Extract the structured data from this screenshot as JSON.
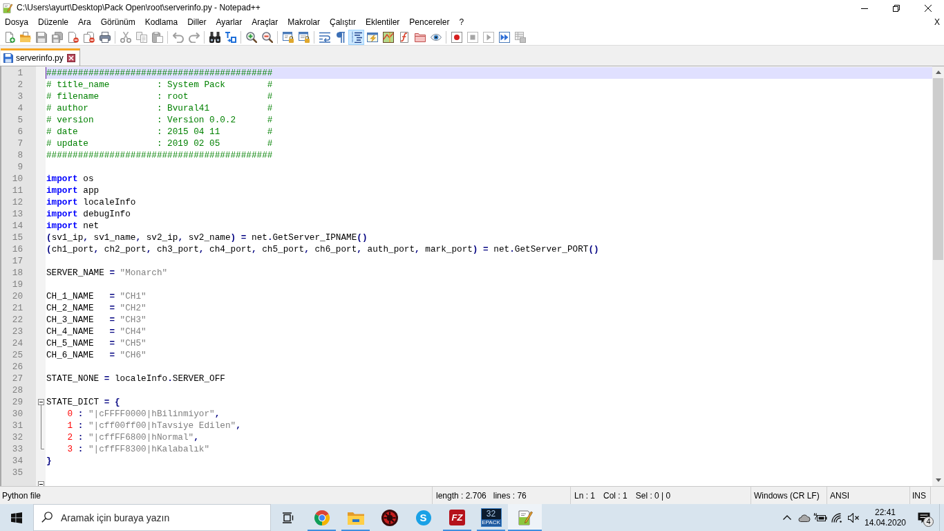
{
  "window": {
    "title": "C:\\Users\\ayurt\\Desktop\\Pack Open\\root\\serverinfo.py - Notepad++"
  },
  "menu_bar": {
    "items": [
      "Dosya",
      "Düzenle",
      "Ara",
      "Görünüm",
      "Kodlama",
      "Diller",
      "Ayarlar",
      "Araçlar",
      "Makrolar",
      "Çalıştır",
      "Eklentiler",
      "Pencereler",
      "?"
    ],
    "close_label": "X"
  },
  "toolbar": {
    "groups": [
      [
        {
          "kind": "new",
          "on": false,
          "disabled": false
        },
        {
          "kind": "open",
          "on": false,
          "disabled": false
        },
        {
          "kind": "save",
          "on": false,
          "disabled": true
        },
        {
          "kind": "saveall",
          "on": false,
          "disabled": true
        },
        {
          "kind": "close",
          "on": false,
          "disabled": false
        },
        {
          "kind": "closeall",
          "on": false,
          "disabled": false
        },
        {
          "kind": "print",
          "on": false,
          "disabled": false
        }
      ],
      [
        {
          "kind": "cut",
          "on": false,
          "disabled": true
        },
        {
          "kind": "copy",
          "on": false,
          "disabled": true
        },
        {
          "kind": "paste",
          "on": false,
          "disabled": true
        }
      ],
      [
        {
          "kind": "undo",
          "on": false,
          "disabled": true
        },
        {
          "kind": "redo",
          "on": false,
          "disabled": true
        }
      ],
      [
        {
          "kind": "find",
          "on": false,
          "disabled": false
        },
        {
          "kind": "replace",
          "on": false,
          "disabled": false
        }
      ],
      [
        {
          "kind": "zoomin",
          "on": false,
          "disabled": false
        },
        {
          "kind": "zoomout",
          "on": false,
          "disabled": false
        }
      ],
      [
        {
          "kind": "syncv",
          "on": false,
          "disabled": false
        },
        {
          "kind": "synch",
          "on": false,
          "disabled": false
        }
      ],
      [
        {
          "kind": "wrap",
          "on": false,
          "disabled": false
        },
        {
          "kind": "symbols",
          "on": false,
          "disabled": false
        },
        {
          "kind": "indent",
          "on": true,
          "disabled": false
        },
        {
          "kind": "language",
          "on": false,
          "disabled": false
        },
        {
          "kind": "docmap",
          "on": false,
          "disabled": false
        },
        {
          "kind": "functions",
          "on": false,
          "disabled": false
        },
        {
          "kind": "workspace",
          "on": false,
          "disabled": false
        },
        {
          "kind": "monitor",
          "on": false,
          "disabled": false
        }
      ],
      [
        {
          "kind": "record",
          "on": false,
          "disabled": false
        },
        {
          "kind": "stop",
          "on": false,
          "disabled": true
        },
        {
          "kind": "play",
          "on": false,
          "disabled": true
        },
        {
          "kind": "playmany",
          "on": false,
          "disabled": false
        },
        {
          "kind": "savemacro",
          "on": false,
          "disabled": true
        }
      ]
    ]
  },
  "tabs": [
    {
      "label": "serverinfo.py",
      "selected": true,
      "modified": false
    }
  ],
  "editor": {
    "lines": [
      {
        "number": "1",
        "kind": "plain",
        "current": true,
        "tokens": [
          {
            "kind": "comment",
            "text": "###########################################"
          }
        ]
      },
      {
        "number": "2",
        "kind": "plain",
        "current": false,
        "tokens": [
          {
            "kind": "comment",
            "text": "# title_name         : System Pack        #"
          }
        ]
      },
      {
        "number": "3",
        "kind": "plain",
        "current": false,
        "tokens": [
          {
            "kind": "comment",
            "text": "# filename           : root               #"
          }
        ]
      },
      {
        "number": "4",
        "kind": "plain",
        "current": false,
        "tokens": [
          {
            "kind": "comment",
            "text": "# author             : Bvural41           #"
          }
        ]
      },
      {
        "number": "5",
        "kind": "plain",
        "current": false,
        "tokens": [
          {
            "kind": "comment",
            "text": "# version            : Version 0.0.2      #"
          }
        ]
      },
      {
        "number": "6",
        "kind": "plain",
        "current": false,
        "tokens": [
          {
            "kind": "comment",
            "text": "# date               : 2015 04 11         #"
          }
        ]
      },
      {
        "number": "7",
        "kind": "plain",
        "current": false,
        "tokens": [
          {
            "kind": "comment",
            "text": "# update             : 2019 02 05         #"
          }
        ]
      },
      {
        "number": "8",
        "kind": "plain",
        "current": false,
        "tokens": [
          {
            "kind": "comment",
            "text": "###########################################"
          }
        ]
      },
      {
        "number": "9",
        "kind": "plain",
        "current": false
      },
      {
        "number": "10",
        "kind": "plain",
        "current": false,
        "tokens": [
          {
            "kind": "keyword",
            "text": "import"
          },
          {
            "kind": "plain",
            "text": " os"
          }
        ]
      },
      {
        "number": "11",
        "kind": "plain",
        "current": false,
        "tokens": [
          {
            "kind": "keyword",
            "text": "import"
          },
          {
            "kind": "plain",
            "text": " app"
          }
        ]
      },
      {
        "number": "12",
        "kind": "plain",
        "current": false,
        "tokens": [
          {
            "kind": "keyword",
            "text": "import"
          },
          {
            "kind": "plain",
            "text": " localeInfo"
          }
        ]
      },
      {
        "number": "13",
        "kind": "plain",
        "current": false,
        "tokens": [
          {
            "kind": "keyword",
            "text": "import"
          },
          {
            "kind": "plain",
            "text": " debugInfo"
          }
        ]
      },
      {
        "number": "14",
        "kind": "plain",
        "current": false,
        "tokens": [
          {
            "kind": "keyword",
            "text": "import"
          },
          {
            "kind": "plain",
            "text": " net"
          }
        ]
      },
      {
        "number": "15",
        "kind": "plain",
        "current": false,
        "tokens": [
          {
            "kind": "operator",
            "text": "("
          },
          {
            "kind": "plain",
            "text": "sv1_ip"
          },
          {
            "kind": "operator",
            "text": ","
          },
          {
            "kind": "plain",
            "text": " sv1_name"
          },
          {
            "kind": "operator",
            "text": ","
          },
          {
            "kind": "plain",
            "text": " sv2_ip"
          },
          {
            "kind": "operator",
            "text": ","
          },
          {
            "kind": "plain",
            "text": " sv2_name"
          },
          {
            "kind": "operator",
            "text": ")"
          },
          {
            "kind": "operator",
            "text": " ="
          },
          {
            "kind": "plain",
            "text": " net"
          },
          {
            "kind": "operator",
            "text": "."
          },
          {
            "kind": "plain",
            "text": "GetServer_IPNAME"
          },
          {
            "kind": "operator",
            "text": "()"
          }
        ]
      },
      {
        "number": "16",
        "kind": "plain",
        "current": false,
        "tokens": [
          {
            "kind": "operator",
            "text": "("
          },
          {
            "kind": "plain",
            "text": "ch1_port"
          },
          {
            "kind": "operator",
            "text": ","
          },
          {
            "kind": "plain",
            "text": " ch2_port"
          },
          {
            "kind": "operator",
            "text": ","
          },
          {
            "kind": "plain",
            "text": " ch3_port"
          },
          {
            "kind": "operator",
            "text": ","
          },
          {
            "kind": "plain",
            "text": " ch4_port"
          },
          {
            "kind": "operator",
            "text": ","
          },
          {
            "kind": "plain",
            "text": " ch5_port"
          },
          {
            "kind": "operator",
            "text": ","
          },
          {
            "kind": "plain",
            "text": " ch6_port"
          },
          {
            "kind": "operator",
            "text": ","
          },
          {
            "kind": "plain",
            "text": " auth_port"
          },
          {
            "kind": "operator",
            "text": ","
          },
          {
            "kind": "plain",
            "text": " mark_port"
          },
          {
            "kind": "operator",
            "text": ")"
          },
          {
            "kind": "operator",
            "text": " ="
          },
          {
            "kind": "plain",
            "text": " net"
          },
          {
            "kind": "operator",
            "text": "."
          },
          {
            "kind": "plain",
            "text": "GetServer_PORT"
          },
          {
            "kind": "operator",
            "text": "()"
          }
        ]
      },
      {
        "number": "17",
        "kind": "plain",
        "current": false
      },
      {
        "number": "18",
        "kind": "plain",
        "current": false,
        "tokens": [
          {
            "kind": "plain",
            "text": "SERVER_NAME "
          },
          {
            "kind": "operator",
            "text": "="
          },
          {
            "kind": "string",
            "text": " \"Monarch\""
          }
        ]
      },
      {
        "number": "19",
        "kind": "plain",
        "current": false
      },
      {
        "number": "20",
        "kind": "plain",
        "current": false,
        "tokens": [
          {
            "kind": "plain",
            "text": "CH_1_NAME   "
          },
          {
            "kind": "operator",
            "text": "="
          },
          {
            "kind": "string",
            "text": " \"CH1\""
          }
        ]
      },
      {
        "number": "21",
        "kind": "plain",
        "current": false,
        "tokens": [
          {
            "kind": "plain",
            "text": "CH_2_NAME   "
          },
          {
            "kind": "operator",
            "text": "="
          },
          {
            "kind": "string",
            "text": " \"CH2\""
          }
        ]
      },
      {
        "number": "22",
        "kind": "plain",
        "current": false,
        "tokens": [
          {
            "kind": "plain",
            "text": "CH_3_NAME   "
          },
          {
            "kind": "operator",
            "text": "="
          },
          {
            "kind": "string",
            "text": " \"CH3\""
          }
        ]
      },
      {
        "number": "23",
        "kind": "plain",
        "current": false,
        "tokens": [
          {
            "kind": "plain",
            "text": "CH_4_NAME   "
          },
          {
            "kind": "operator",
            "text": "="
          },
          {
            "kind": "string",
            "text": " \"CH4\""
          }
        ]
      },
      {
        "number": "24",
        "kind": "plain",
        "current": false,
        "tokens": [
          {
            "kind": "plain",
            "text": "CH_5_NAME   "
          },
          {
            "kind": "operator",
            "text": "="
          },
          {
            "kind": "string",
            "text": " \"CH5\""
          }
        ]
      },
      {
        "number": "25",
        "kind": "plain",
        "current": false,
        "tokens": [
          {
            "kind": "plain",
            "text": "CH_6_NAME   "
          },
          {
            "kind": "operator",
            "text": "="
          },
          {
            "kind": "string",
            "text": " \"CH6\""
          }
        ]
      },
      {
        "number": "26",
        "kind": "plain",
        "current": false
      },
      {
        "number": "27",
        "kind": "plain",
        "current": false,
        "tokens": [
          {
            "kind": "plain",
            "text": "STATE_NONE "
          },
          {
            "kind": "operator",
            "text": "="
          },
          {
            "kind": "plain",
            "text": " localeInfo"
          },
          {
            "kind": "operator",
            "text": "."
          },
          {
            "kind": "plain",
            "text": "SERVER_OFF"
          }
        ]
      },
      {
        "number": "28",
        "kind": "plain",
        "current": false
      },
      {
        "number": "29",
        "kind": "foldstart",
        "expanded": true,
        "current": false,
        "tokens": [
          {
            "kind": "plain",
            "text": "STATE_DICT "
          },
          {
            "kind": "operator",
            "text": "= {"
          }
        ]
      },
      {
        "number": "30",
        "kind": "foldbody",
        "current": false,
        "tokens": [
          {
            "kind": "number",
            "text": "    0"
          },
          {
            "kind": "operator",
            "text": " :"
          },
          {
            "kind": "string",
            "text": " \"|cFFFF0000|hBilinmiyor\""
          },
          {
            "kind": "operator",
            "text": ","
          }
        ]
      },
      {
        "number": "31",
        "kind": "foldbody",
        "current": false,
        "tokens": [
          {
            "kind": "number",
            "text": "    1"
          },
          {
            "kind": "operator",
            "text": " :"
          },
          {
            "kind": "string",
            "text": " \"|cff00ff00|hTavsiye Edilen\""
          },
          {
            "kind": "operator",
            "text": ","
          }
        ]
      },
      {
        "number": "32",
        "kind": "foldbody",
        "current": false,
        "tokens": [
          {
            "kind": "number",
            "text": "    2"
          },
          {
            "kind": "operator",
            "text": " :"
          },
          {
            "kind": "string",
            "text": " \"|cffFF6800|hNormal\""
          },
          {
            "kind": "operator",
            "text": ","
          }
        ]
      },
      {
        "number": "33",
        "kind": "foldend",
        "current": false,
        "tokens": [
          {
            "kind": "number",
            "text": "    3"
          },
          {
            "kind": "operator",
            "text": " :"
          },
          {
            "kind": "string",
            "text": " \"|cffFF8300|hKalabalık\""
          }
        ]
      },
      {
        "number": "34",
        "kind": "plain",
        "current": false,
        "tokens": [
          {
            "kind": "operator",
            "text": "}"
          }
        ]
      },
      {
        "number": "35",
        "kind": "plain",
        "current": false
      },
      {
        "kind": "foldstart",
        "expanded": true,
        "current": false
      }
    ]
  },
  "status_bar": {
    "file_type": "Python file",
    "length": "length : 2.706",
    "lines": "lines : 76",
    "line": "Ln : 1",
    "column": "Col : 1",
    "selection": "Sel : 0 | 0",
    "line_endings": "Windows (CR LF)",
    "encoding": "ANSI",
    "mode": "INS"
  },
  "taskbar": {
    "search": {
      "placeholder": "Aramak için buraya yazın"
    },
    "apps": [
      {
        "kind": "browser",
        "running": true,
        "active": false
      },
      {
        "kind": "folder",
        "running": true,
        "active": false
      },
      {
        "kind": "booster",
        "running": false,
        "active": false
      },
      {
        "kind": "chat",
        "glyph": "S",
        "running": false,
        "active": false
      },
      {
        "kind": "ftp",
        "glyph": "FZ",
        "running": true,
        "active": false
      },
      {
        "kind": "packer",
        "glyph": "32",
        "caption": "EPACK",
        "running": true,
        "active": false
      },
      {
        "kind": "editor",
        "running": true,
        "active": true
      }
    ],
    "tray": {
      "muted": true
    },
    "clock": {
      "time": "22:41",
      "date": "14.04.2020"
    },
    "notifications": {
      "count": "4"
    }
  }
}
